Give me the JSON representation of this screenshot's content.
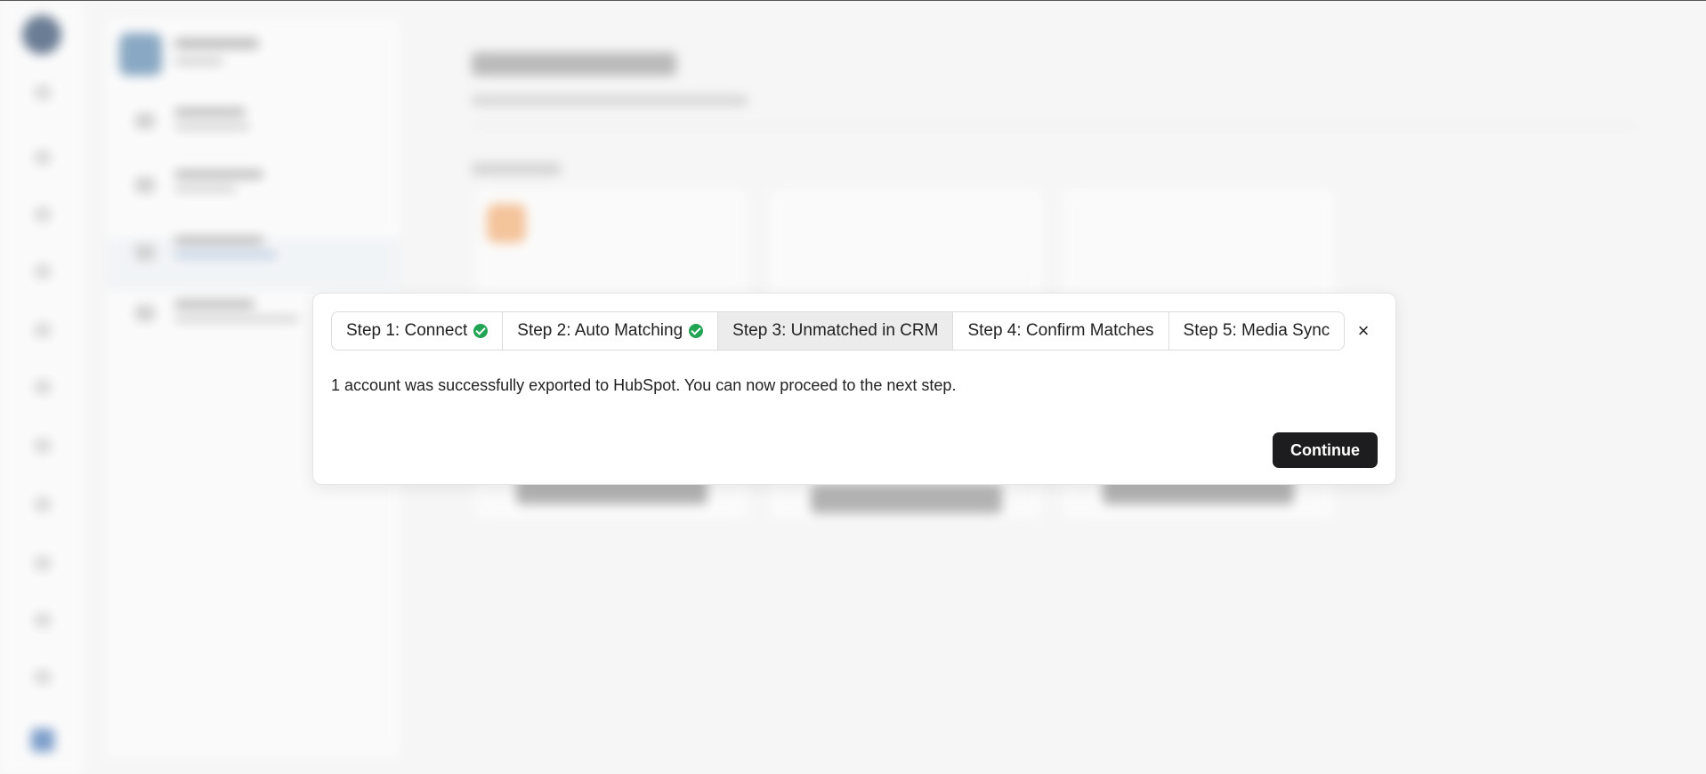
{
  "wizard": {
    "steps": [
      {
        "label": "Step 1: Connect",
        "completed": true
      },
      {
        "label": "Step 2: Auto Matching",
        "completed": true
      },
      {
        "label": "Step 3: Unmatched in CRM",
        "completed": false,
        "active": true
      },
      {
        "label": "Step 4: Confirm Matches",
        "completed": false
      },
      {
        "label": "Step 5: Media Sync",
        "completed": false
      }
    ],
    "close_glyph": "×",
    "message": "1 account was successfully exported to HubSpot. You can now proceed to the next step.",
    "continue_label": "Continue"
  },
  "colors": {
    "check_green": "#22a455",
    "primary_button": "#1d1d1f",
    "active_step_bg": "#ececec"
  },
  "icons": {
    "completed_step": "check-circle-icon",
    "close": "close-icon"
  }
}
